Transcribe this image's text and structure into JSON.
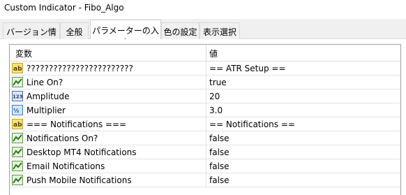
{
  "window": {
    "title": "Custom Indicator - Fibo_Algo"
  },
  "tabs": [
    {
      "label": "バージョン情報",
      "active": false
    },
    {
      "label": "全般",
      "active": false
    },
    {
      "label": "パラメーターの入力",
      "active": true
    },
    {
      "label": "色の設定",
      "active": false
    },
    {
      "label": "表示選択",
      "active": false
    }
  ],
  "grid": {
    "headers": {
      "variable": "変数",
      "value": "値"
    },
    "rows": [
      {
        "icon": "string-ab-icon",
        "name": "????????????????????????",
        "value": "== ATR Setup =="
      },
      {
        "icon": "bool-chart-icon",
        "name": "Line On?",
        "value": "true"
      },
      {
        "icon": "integer-123-icon",
        "name": "Amplitude",
        "value": "20"
      },
      {
        "icon": "double-half-icon",
        "name": "Multiplier",
        "value": "3.0"
      },
      {
        "icon": "string-ab-icon",
        "name": "=== Notifications ===",
        "value": "== Notifications =="
      },
      {
        "icon": "bool-chart-icon",
        "name": "Notifications On?",
        "value": "false"
      },
      {
        "icon": "bool-chart-icon",
        "name": "Desktop MT4 Notifications",
        "value": "false"
      },
      {
        "icon": "bool-chart-icon",
        "name": "Email Notifications",
        "value": "false"
      },
      {
        "icon": "bool-chart-icon",
        "name": "Push Mobile Notifications",
        "value": "false"
      }
    ]
  }
}
